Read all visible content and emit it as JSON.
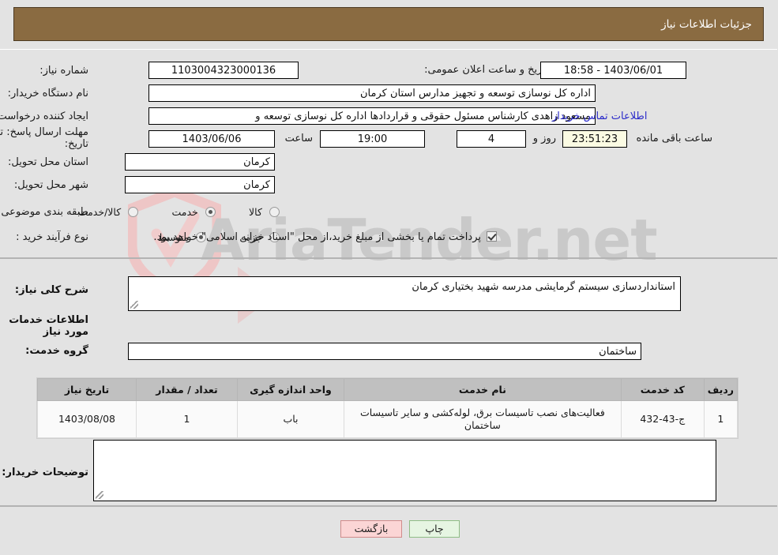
{
  "header": {
    "title": "جزئیات اطلاعات نیاز",
    "bg_color": "#8a6b41"
  },
  "fields": {
    "need_number_label": "شماره نیاز:",
    "need_number_value": "1103004323000136",
    "public_announce_label": "تاریخ و ساعت اعلان عمومی:",
    "public_announce_value": "1403/06/01 - 18:58",
    "buyer_org_label": "نام دستگاه خریدار:",
    "buyer_org_value": "اداره کل نوسازی  توسعه و تجهیز مدارس استان کرمان",
    "creator_label": "ایجاد کننده درخواست:",
    "creator_value": "مسعود زاهدی کارشناس مسئول حقوقی و قراردادها اداره کل نوسازی  توسعه و",
    "contact_link": "اطلاعات تماس خریدار",
    "deadline_label_line1": "مهلت ارسال پاسخ: تا",
    "deadline_label_line2": "تاریخ:",
    "deadline_date": "1403/06/06",
    "deadline_time_label": "ساعت",
    "deadline_time": "19:00",
    "remaining_days": "4",
    "remaining_days_label": "روز و",
    "remaining_clock": "23:51:23",
    "remaining_clock_label": "ساعت باقی مانده",
    "province_label": "استان محل تحویل:",
    "province_value": "کرمان",
    "city_label": "شهر محل تحویل:",
    "city_value": "کرمان",
    "category_label": "طبقه بندی موضوعی:",
    "process_label": "نوع فرآیند خرید :",
    "islamic_treasury_note": "پرداخت تمام یا بخشی از مبلغ خرید،از محل \"اسناد خزانه اسلامی\" خواهد بود."
  },
  "category_options": [
    {
      "label": "کالا",
      "selected": false
    },
    {
      "label": "خدمت",
      "selected": true
    },
    {
      "label": "کالا/خدمت",
      "selected": false
    }
  ],
  "process_options": [
    {
      "label": "جزیی",
      "selected": false
    },
    {
      "label": "متوسط",
      "selected": true
    }
  ],
  "islamic_treasury_checked": true,
  "description": {
    "label": "شرح کلی نیاز:",
    "value": "استانداردسازی سیستم گرمایشی مدرسه شهید بختیاری کرمان"
  },
  "services_section": {
    "title": "اطلاعات خدمات مورد نیاز",
    "group_label": "گروه خدمت:",
    "group_value": "ساختمان"
  },
  "table": {
    "columns": [
      "ردیف",
      "کد خدمت",
      "نام خدمت",
      "واحد اندازه گیری",
      "تعداد / مقدار",
      "تاریخ نیاز"
    ],
    "rows": [
      {
        "index": "1",
        "code": "ج-43-432",
        "name": "فعالیت‌های نصب تاسیسات برق، لوله‌کشی و سایر تاسیسات ساختمان",
        "unit": "باب",
        "quantity": "1",
        "date": "1403/08/08"
      }
    ]
  },
  "buyer_notes": {
    "label": "توضیحات خریدار:",
    "value": ""
  },
  "footer": {
    "back_label": "بازگشت",
    "print_label": "چاپ"
  },
  "watermark": {
    "text": "AriaTender.net"
  }
}
